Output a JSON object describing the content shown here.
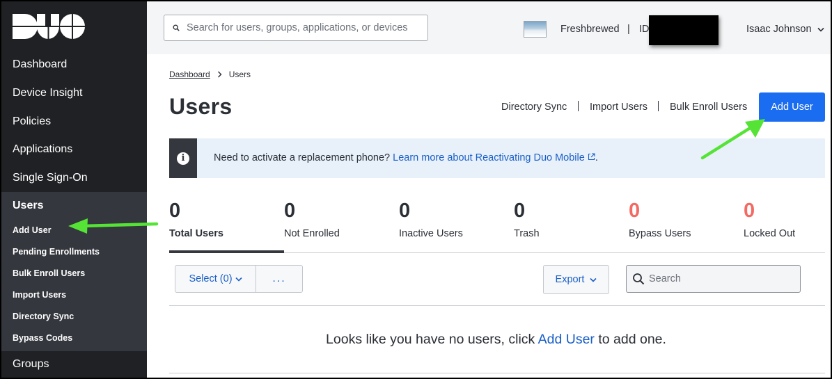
{
  "brand": {
    "logo_text": "DUO"
  },
  "sidebar": {
    "items": [
      {
        "label": "Dashboard"
      },
      {
        "label": "Device Insight"
      },
      {
        "label": "Policies"
      },
      {
        "label": "Applications"
      },
      {
        "label": "Single Sign-On"
      }
    ],
    "users": {
      "label": "Users",
      "children": [
        {
          "label": "Add User"
        },
        {
          "label": "Pending Enrollments"
        },
        {
          "label": "Bulk Enroll Users"
        },
        {
          "label": "Import Users"
        },
        {
          "label": "Directory Sync"
        },
        {
          "label": "Bypass Codes"
        }
      ]
    },
    "groups_label": "Groups"
  },
  "topbar": {
    "search_placeholder": "Search for users, groups, applications, or devices",
    "account_name": "Freshbrewed",
    "separator": "|",
    "account_id_prefix": "ID",
    "user_name": "Isaac Johnson"
  },
  "breadcrumb": {
    "root": "Dashboard",
    "current": "Users"
  },
  "page": {
    "title": "Users",
    "actions": [
      "Directory Sync",
      "Import Users",
      "Bulk Enroll Users"
    ],
    "add_user_label": "Add User"
  },
  "alert": {
    "text": "Need to activate a replacement phone?",
    "link": "Learn more about Reactivating Duo Mobile",
    "suffix": "."
  },
  "stats": [
    {
      "value": "0",
      "label": "Total Users",
      "active": true,
      "alert": false
    },
    {
      "value": "0",
      "label": "Not Enrolled",
      "active": false,
      "alert": false
    },
    {
      "value": "0",
      "label": "Inactive Users",
      "active": false,
      "alert": false
    },
    {
      "value": "0",
      "label": "Trash",
      "active": false,
      "alert": false
    },
    {
      "value": "0",
      "label": "Bypass Users",
      "active": false,
      "alert": true
    },
    {
      "value": "0",
      "label": "Locked Out",
      "active": false,
      "alert": true
    }
  ],
  "toolbar": {
    "select_label": "Select (0)",
    "more_label": "...",
    "export_label": "Export",
    "search_placeholder": "Search"
  },
  "empty": {
    "before": "Looks like you have no users, click",
    "link": "Add User",
    "after": "to add one."
  },
  "colors": {
    "sidebar_bg": "#202124",
    "sidebar_active_bg": "#34373d",
    "primary": "#1a6cf0",
    "link": "#1a5fc8",
    "stat_alert": "#f26a63",
    "annotation_arrow": "#55e336"
  }
}
